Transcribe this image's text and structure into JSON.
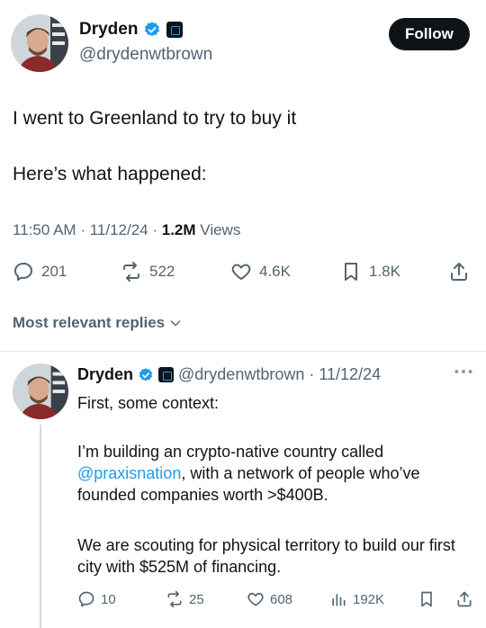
{
  "main_tweet": {
    "author_name": "Dryden",
    "author_handle": "@drydenwtbrown",
    "follow_label": "Follow",
    "text_line1": "I went to Greenland to try to buy it",
    "text_line2": "Here’s what happened:",
    "time": "11:50 AM",
    "date": "11/12/24",
    "views_count": "1.2M",
    "views_label": "Views",
    "replies": "201",
    "reposts": "522",
    "likes": "4.6K",
    "bookmarks": "1.8K"
  },
  "replies_header": {
    "label": "Most relevant replies"
  },
  "reply": {
    "author_name": "Dryden",
    "author_handle": "@drydenwtbrown",
    "date": "11/12/24",
    "line1": "First, some context:",
    "p2_pre": "I’m building an crypto-native country called ",
    "p2_link": "@praxisnation",
    "p2_post": ", with a network of people who’ve founded companies worth >$400B.",
    "p3": "We are scouting for physical territory to build our first city with $525M of financing.",
    "replies": "10",
    "reposts": "25",
    "likes": "608",
    "views": "192K"
  },
  "colors": {
    "accent": "#1d9bf0",
    "text": "#0f1419",
    "secondary": "#536471"
  },
  "icons": [
    "verified-badge-icon",
    "affiliate-badge-icon",
    "reply-icon",
    "repost-icon",
    "like-icon",
    "bookmark-icon",
    "share-icon",
    "views-icon",
    "chevron-down-icon",
    "more-icon"
  ]
}
